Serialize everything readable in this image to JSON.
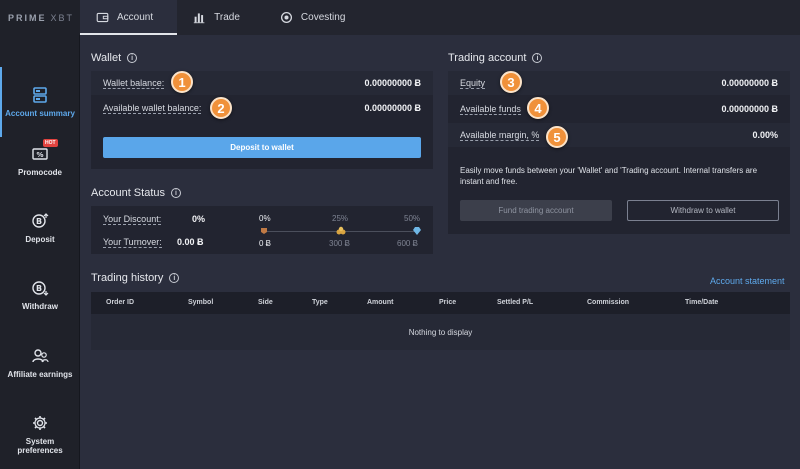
{
  "brand": {
    "logo_main": "PRIME",
    "logo_sub": "XBT"
  },
  "tabs": [
    {
      "label": "Account",
      "icon": "wallet-icon",
      "active": true
    },
    {
      "label": "Trade",
      "icon": "bar-chart-icon"
    },
    {
      "label": "Covesting",
      "icon": "covesting-icon"
    }
  ],
  "sidebar": {
    "items": [
      {
        "label": "Account summary",
        "icon": "account-summary-icon",
        "active": true
      },
      {
        "label": "Promocode",
        "icon": "promocode-icon",
        "badge": "HOT"
      },
      {
        "label": "Deposit",
        "icon": "deposit-icon"
      },
      {
        "label": "Withdraw",
        "icon": "withdraw-icon"
      },
      {
        "label": "Affiliate earnings",
        "icon": "affiliate-icon"
      },
      {
        "label": "System preferences",
        "icon": "gear-icon"
      }
    ]
  },
  "wallet": {
    "title": "Wallet",
    "rows": [
      {
        "label": "Wallet balance:",
        "value": "0.00000000 Ƀ",
        "marker": "1"
      },
      {
        "label": "Available wallet balance:",
        "value": "0.00000000 Ƀ",
        "marker": "2"
      }
    ],
    "deposit_button": "Deposit to wallet"
  },
  "trading_account": {
    "title": "Trading account",
    "rows": [
      {
        "label": "Equity",
        "value": "0.00000000 Ƀ",
        "marker": "3"
      },
      {
        "label": "Available funds",
        "value": "0.00000000 Ƀ",
        "marker": "4"
      },
      {
        "label": "Available margin, %",
        "value": "0.00%",
        "marker": "5"
      }
    ],
    "description": "Easily move funds between your 'Wallet' and 'Trading account. Internal transfers are instant and free.",
    "fund_button": "Fund trading account",
    "withdraw_button": "Withdraw to wallet"
  },
  "account_status": {
    "title": "Account Status",
    "discount_label": "Your Discount:",
    "discount_value": "0%",
    "turnover_label": "Your Turnover:",
    "turnover_value": "0.00 Ƀ",
    "tiers": [
      {
        "pct": "0%",
        "amount": "0 Ƀ",
        "active": true
      },
      {
        "pct": "25%",
        "amount": "300 Ƀ"
      },
      {
        "pct": "50%",
        "amount": "600 Ƀ"
      }
    ]
  },
  "trading_history": {
    "title": "Trading history",
    "statement_link": "Account statement",
    "columns": [
      "Order ID",
      "Symbol",
      "Side",
      "Type",
      "Amount",
      "Price",
      "Settled P/L",
      "Commission",
      "Time/Date"
    ],
    "empty_text": "Nothing to display"
  },
  "colors": {
    "accent": "#5ea9ec",
    "marker": "#f0913a",
    "background": "#2b2e3d"
  }
}
